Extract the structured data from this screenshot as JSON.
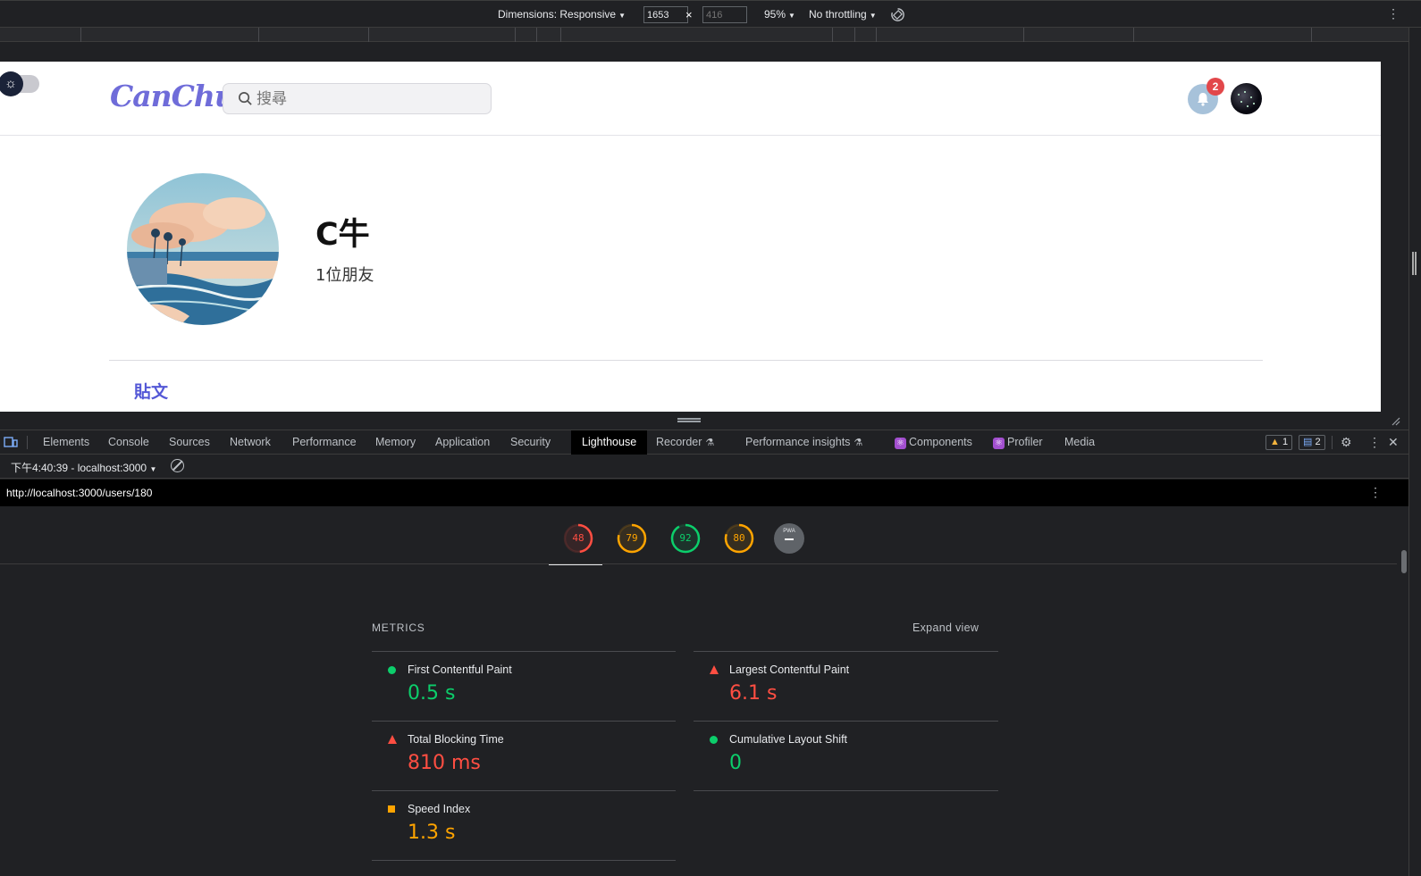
{
  "colors": {
    "pass": "#0cce6b",
    "average": "#ffa400",
    "fail": "#ff4e42",
    "brand": "#6f6cd9",
    "link": "#5458d6"
  },
  "device_toolbar": {
    "dimensions_label": "Dimensions: Responsive",
    "width_value": "1653",
    "height_placeholder": "416",
    "times": "×",
    "zoom": "95%",
    "throttling": "No throttling",
    "menu_icon": "more-vert-icon"
  },
  "site": {
    "theme_icon": "sun-icon",
    "logo": "CanChu",
    "search_placeholder": "搜尋",
    "notification_count": "2",
    "profile": {
      "name": "C牛",
      "friends": "1位朋友"
    },
    "tab_posts": "貼文"
  },
  "devtools": {
    "tabs": [
      "Elements",
      "Console",
      "Sources",
      "Network",
      "Performance",
      "Memory",
      "Application",
      "Security",
      "Lighthouse",
      "Recorder",
      "Performance insights",
      "Components",
      "Profiler",
      "Media"
    ],
    "active_tab": "Lighthouse",
    "warnings": "1",
    "messages": "2",
    "report_selector": "下午4:40:39 - localhost:3000",
    "url": "http://localhost:3000/users/180"
  },
  "lighthouse": {
    "scores": [
      {
        "category": "Performance",
        "value": 48,
        "rating": "fail"
      },
      {
        "category": "Accessibility",
        "value": 79,
        "rating": "average"
      },
      {
        "category": "Best Practices",
        "value": 92,
        "rating": "pass"
      },
      {
        "category": "SEO",
        "value": 80,
        "rating": "average"
      }
    ],
    "pwa_label": "PWA",
    "metrics_title": "METRICS",
    "expand_view": "Expand view",
    "metrics": [
      {
        "label": "First Contentful Paint",
        "value": "0.5 s",
        "rating": "pass"
      },
      {
        "label": "Largest Contentful Paint",
        "value": "6.1 s",
        "rating": "fail"
      },
      {
        "label": "Total Blocking Time",
        "value": "810 ms",
        "rating": "fail"
      },
      {
        "label": "Cumulative Layout Shift",
        "value": "0",
        "rating": "pass"
      },
      {
        "label": "Speed Index",
        "value": "1.3 s",
        "rating": "average"
      }
    ]
  }
}
